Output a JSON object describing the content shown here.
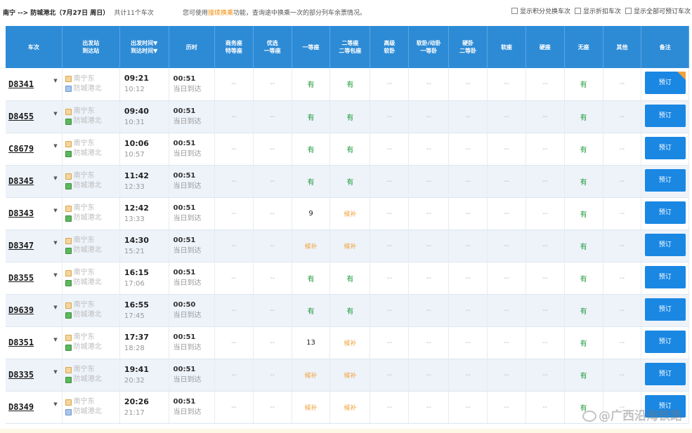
{
  "header": {
    "route": "南宁 --> 防城港北（7月27日 周日）",
    "count": "共计11个车次",
    "notice_pre": "您可使用",
    "notice_hl": "接续换乘",
    "notice_post": "功能，查询途中换乘一次的部分列车余票情况。",
    "filters": [
      "显示积分兑换车次",
      "显示折扣车次",
      "显示全部可预订车次"
    ]
  },
  "columns": [
    {
      "l1": "车次",
      "l2": ""
    },
    {
      "l1": "出发站",
      "l2": "到达站"
    },
    {
      "l1": "出发时间▼",
      "l2": "到达时间▼"
    },
    {
      "l1": "历时",
      "l2": ""
    },
    {
      "l1": "商务座",
      "l2": "特等座"
    },
    {
      "l1": "优选",
      "l2": "一等座"
    },
    {
      "l1": "一等座",
      "l2": ""
    },
    {
      "l1": "二等座",
      "l2": "二等包座"
    },
    {
      "l1": "高级",
      "l2": "软卧"
    },
    {
      "l1": "软卧/动卧",
      "l2": "一等卧"
    },
    {
      "l1": "硬卧",
      "l2": "二等卧"
    },
    {
      "l1": "软座",
      "l2": ""
    },
    {
      "l1": "硬座",
      "l2": ""
    },
    {
      "l1": "无座",
      "l2": ""
    },
    {
      "l1": "其他",
      "l2": ""
    },
    {
      "l1": "备注",
      "l2": ""
    }
  ],
  "rows": [
    {
      "train": "D8341",
      "from": "南宁东",
      "to": "防城港北",
      "dep": "09:21",
      "arr": "10:12",
      "dur": "00:51",
      "day": "当日到达",
      "first": "有",
      "second": "有",
      "noseat": "有"
    },
    {
      "train": "D8455",
      "from": "南宁东",
      "to": "防城港北",
      "dep": "09:40",
      "arr": "10:31",
      "dur": "00:51",
      "day": "当日到达",
      "first": "有",
      "second": "有",
      "noseat": "有"
    },
    {
      "train": "C8679",
      "from": "南宁东",
      "to": "防城港北",
      "dep": "10:06",
      "arr": "10:57",
      "dur": "00:51",
      "day": "当日到达",
      "first": "有",
      "second": "有",
      "noseat": "有"
    },
    {
      "train": "D8345",
      "from": "南宁东",
      "to": "防城港北",
      "dep": "11:42",
      "arr": "12:33",
      "dur": "00:51",
      "day": "当日到达",
      "first": "有",
      "second": "有",
      "noseat": "有"
    },
    {
      "train": "D8343",
      "from": "南宁东",
      "to": "防城港北",
      "dep": "12:42",
      "arr": "13:33",
      "dur": "00:51",
      "day": "当日到达",
      "first": "9",
      "second": "候补",
      "noseat": "有"
    },
    {
      "train": "D8347",
      "from": "南宁东",
      "to": "防城港北",
      "dep": "14:30",
      "arr": "15:21",
      "dur": "00:51",
      "day": "当日到达",
      "first": "候补",
      "second": "候补",
      "noseat": "有"
    },
    {
      "train": "D8355",
      "from": "南宁东",
      "to": "防城港北",
      "dep": "16:15",
      "arr": "17:06",
      "dur": "00:51",
      "day": "当日到达",
      "first": "有",
      "second": "有",
      "noseat": "有"
    },
    {
      "train": "D9639",
      "from": "南宁东",
      "to": "防城港北",
      "dep": "16:55",
      "arr": "17:45",
      "dur": "00:50",
      "day": "当日到达",
      "first": "有",
      "second": "有",
      "noseat": "有"
    },
    {
      "train": "D8351",
      "from": "南宁东",
      "to": "防城港北",
      "dep": "17:37",
      "arr": "18:28",
      "dur": "00:51",
      "day": "当日到达",
      "first": "13",
      "second": "候补",
      "noseat": "有"
    },
    {
      "train": "D8335",
      "from": "南宁东",
      "to": "防城港北",
      "dep": "19:41",
      "arr": "20:32",
      "dur": "00:51",
      "day": "当日到达",
      "first": "候补",
      "second": "候补",
      "noseat": "有"
    },
    {
      "train": "D8349",
      "from": "南宁东",
      "to": "防城港北",
      "dep": "20:26",
      "arr": "21:17",
      "dur": "00:51",
      "day": "当日到达",
      "first": "候补",
      "second": "候补",
      "noseat": "有"
    }
  ],
  "none_mark": "--",
  "book_label": "预订",
  "watermark": "@广西沿海铁路",
  "colors": {
    "header_bg": "#2d8bd6",
    "book_btn": "#1a87e3",
    "available": "#1e9a3a",
    "waitlist": "#f0a23a"
  }
}
